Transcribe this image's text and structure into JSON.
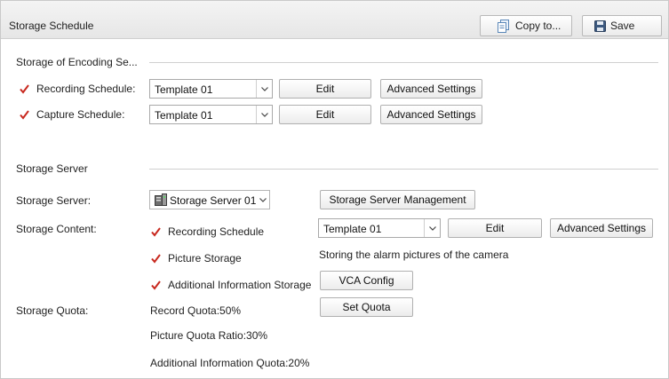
{
  "header": {
    "title": "Storage Schedule",
    "copy_label": "Copy to...",
    "save_label": "Save"
  },
  "encoding": {
    "section_title": "Storage of Encoding Se...",
    "rows": [
      {
        "label": "Recording Schedule:",
        "checked": true,
        "template": "Template 01",
        "edit": "Edit",
        "advanced": "Advanced Settings"
      },
      {
        "label": "Capture Schedule:",
        "checked": true,
        "template": "Template 01",
        "edit": "Edit",
        "advanced": "Advanced Settings"
      }
    ]
  },
  "server": {
    "section_title": "Storage Server",
    "server_label": "Storage Server:",
    "server_value": "Storage Server 01",
    "management_button": "Storage Server Management",
    "content_label": "Storage Content:",
    "recording_schedule": "Recording Schedule",
    "recording_template": "Template 01",
    "edit": "Edit",
    "advanced": "Advanced Settings",
    "picture_storage": "Picture Storage",
    "picture_note": "Storing the alarm pictures of the camera",
    "additional_storage": "Additional Information Storage",
    "vca_config": "VCA Config",
    "quota_label": "Storage Quota:",
    "record_quota": "Record Quota:50%",
    "set_quota": "Set Quota",
    "picture_quota": "Picture Quota Ratio:30%",
    "additional_quota": "Additional Information Quota:20%"
  },
  "colors": {
    "check": "#c8281e",
    "accent": "#2f6fb3"
  }
}
